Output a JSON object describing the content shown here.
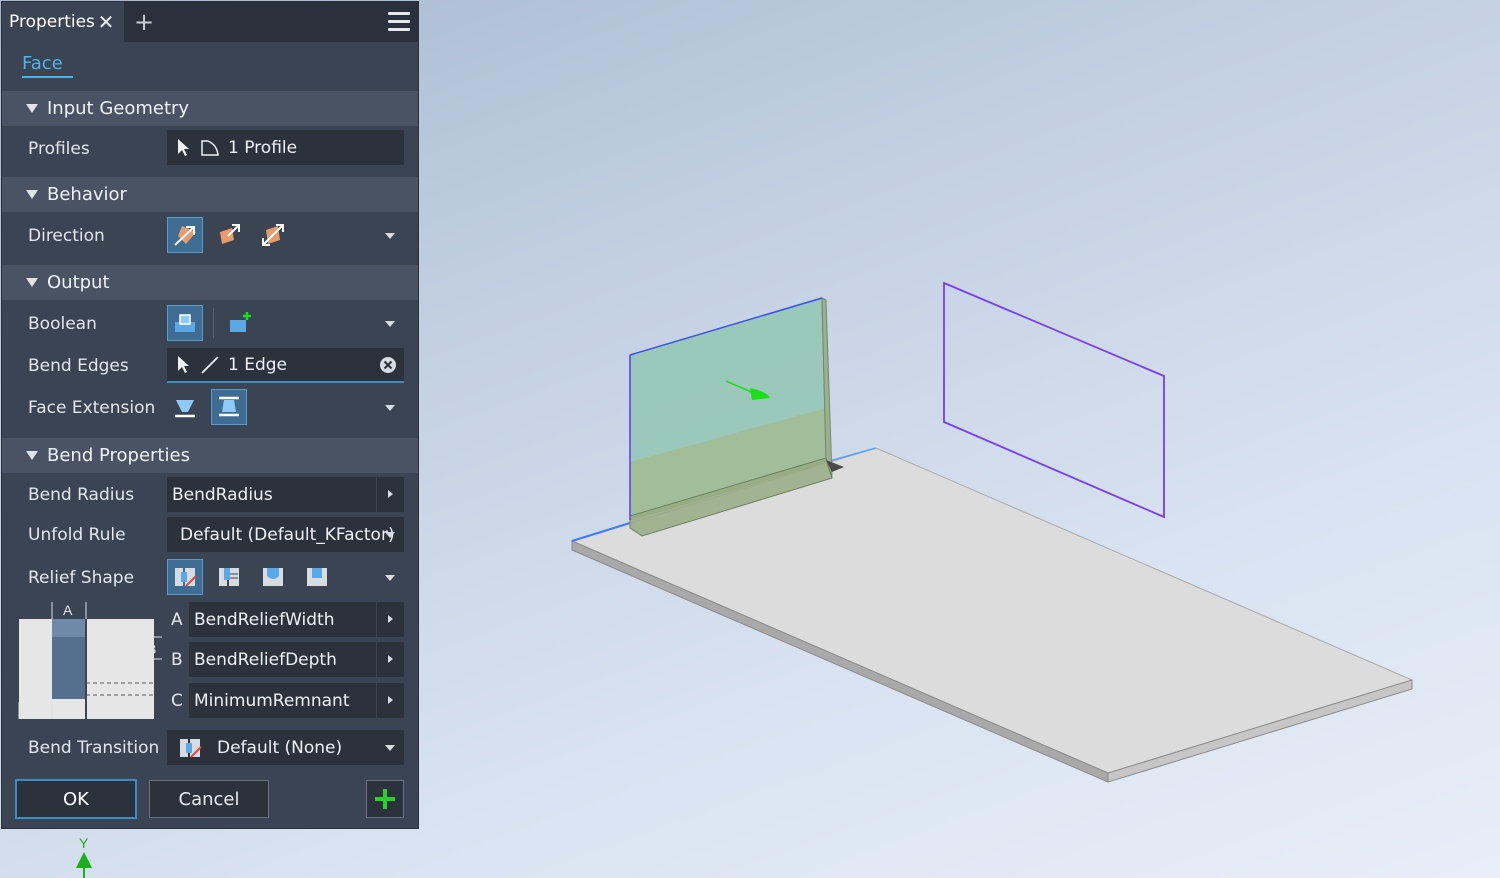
{
  "tabbar": {
    "tab_label": "Properties"
  },
  "face_tab": {
    "label": "Face"
  },
  "sections": {
    "input_geometry": "Input Geometry",
    "behavior": "Behavior",
    "output": "Output",
    "bend_properties": "Bend Properties"
  },
  "input_geometry": {
    "profiles_label": "Profiles",
    "profiles_value": "1 Profile"
  },
  "behavior": {
    "direction_label": "Direction"
  },
  "output": {
    "boolean_label": "Boolean",
    "bend_edges_label": "Bend Edges",
    "bend_edges_value": "1 Edge",
    "face_extension_label": "Face Extension"
  },
  "bend_properties": {
    "bend_radius_label": "Bend Radius",
    "bend_radius_value": "BendRadius",
    "unfold_rule_label": "Unfold Rule",
    "unfold_rule_value": "Default (Default_KFactor)",
    "relief_shape_label": "Relief Shape",
    "relief_diagram": {
      "a": "A",
      "b": "B",
      "c": "C"
    },
    "relief_params": [
      {
        "letter": "A",
        "value": "BendReliefWidth"
      },
      {
        "letter": "B",
        "value": "BendReliefDepth"
      },
      {
        "letter": "C",
        "value": "MinimumRemnant"
      }
    ],
    "bend_transition_label": "Bend Transition",
    "bend_transition_value": "Default (None)"
  },
  "footer": {
    "ok_label": "OK",
    "cancel_label": "Cancel"
  },
  "axis": {
    "y_label": "Y"
  },
  "colors": {
    "accent": "#4eb3ea",
    "panel_bg": "#3b4453",
    "section_bg": "#4a5364",
    "field_bg": "#2c323c",
    "profile_sketch": "#7a3cf0",
    "direction_arrow": "#19e019",
    "icon_orange": "#e99a6b"
  }
}
